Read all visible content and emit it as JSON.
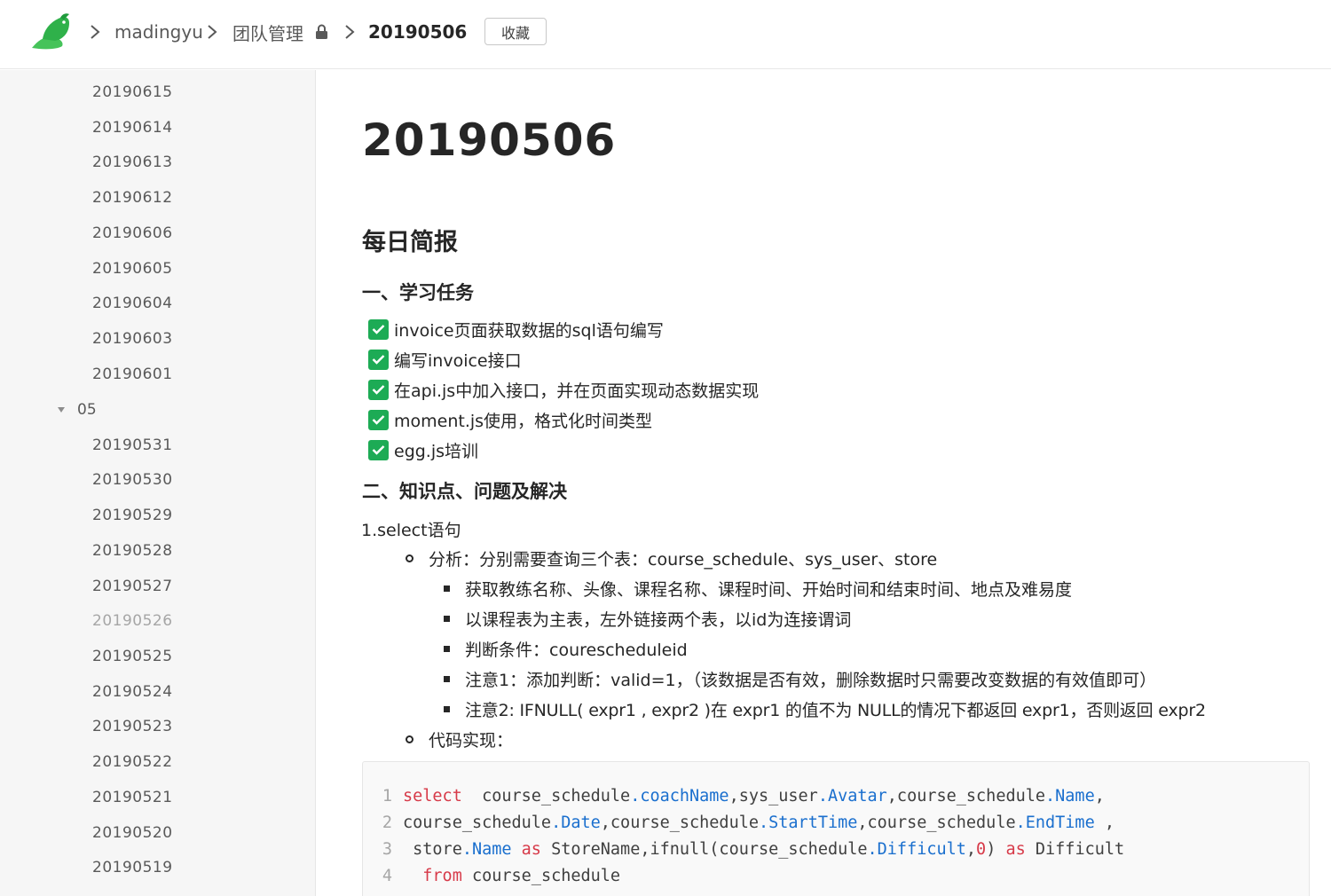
{
  "header": {
    "breadcrumb": {
      "user": "madingyu",
      "team": "团队管理",
      "doc": "20190506"
    },
    "favorite_label": "收藏"
  },
  "sidebar": {
    "items_top": [
      "20190615",
      "20190614",
      "20190613",
      "20190612",
      "20190606",
      "20190605",
      "20190604",
      "20190603",
      "20190601"
    ],
    "group_label": "05",
    "items_group": [
      "20190531",
      "20190530",
      "20190529",
      "20190528",
      "20190527",
      "20190526",
      "20190525",
      "20190524",
      "20190523",
      "20190522",
      "20190521",
      "20190520",
      "20190519"
    ]
  },
  "doc": {
    "title": "20190506",
    "heading": "每日简报",
    "section1": "一、学习任务",
    "tasks": [
      "invoice页面获取数据的sql语句编写",
      "编写invoice接口",
      "在api.js中加入接口，并在页面实现动态数据实现",
      "moment.js使用，格式化时间类型",
      "egg.js培训"
    ],
    "section2": "二、知识点、问题及解决",
    "para1": "1.select语句",
    "analysis": "分析：分别需要查询三个表：course_schedule、sys_user、store",
    "bullets": [
      "获取教练名称、头像、课程名称、课程时间、开始时间和结束时间、地点及难易度",
      "以课程表为主表，左外链接两个表，以id为连接谓词",
      "判断条件：courescheduleid",
      "注意1：添加判断：valid=1，（该数据是否有效，删除数据时只需要改变数据的有效值即可）",
      "注意2: IFNULL( expr1 , expr2 )在 expr1 的值不为 NULL的情况下都返回 expr1，否则返回 expr2"
    ],
    "code_label": "代码实现：",
    "code_lines": [
      {
        "n": "1",
        "parts": [
          [
            "kw",
            "select"
          ],
          [
            "tx",
            "  course_schedule"
          ],
          [
            "pr",
            ".coachName"
          ],
          [
            "tx",
            ",sys_user"
          ],
          [
            "pr",
            ".Avatar"
          ],
          [
            "tx",
            ",course_schedule"
          ],
          [
            "pr",
            ".Name"
          ],
          [
            "tx",
            ","
          ]
        ]
      },
      {
        "n": "2",
        "parts": [
          [
            "tx",
            "course_schedule"
          ],
          [
            "pr",
            ".Date"
          ],
          [
            "tx",
            ",course_schedule"
          ],
          [
            "pr",
            ".StartTime"
          ],
          [
            "tx",
            ",course_schedule"
          ],
          [
            "pr",
            ".EndTime"
          ],
          [
            "tx",
            " ,"
          ]
        ]
      },
      {
        "n": "3",
        "parts": [
          [
            "tx",
            " store"
          ],
          [
            "pr",
            ".Name"
          ],
          [
            "tx",
            " "
          ],
          [
            "kw",
            "as"
          ],
          [
            "tx",
            " StoreName,ifnull(course_schedule"
          ],
          [
            "pr",
            ".Difficult"
          ],
          [
            "tx",
            ","
          ],
          [
            "nm",
            "0"
          ],
          [
            "tx",
            ") "
          ],
          [
            "kw",
            "as"
          ],
          [
            "tx",
            " Difficult"
          ]
        ]
      },
      {
        "n": "4",
        "parts": [
          [
            "tx",
            "  "
          ],
          [
            "kw",
            "from"
          ],
          [
            "tx",
            " course_schedule"
          ]
        ]
      }
    ]
  },
  "colors": {
    "accent_green": "#1dab55",
    "keyword": "#d73a49",
    "property": "#1a6fce"
  }
}
